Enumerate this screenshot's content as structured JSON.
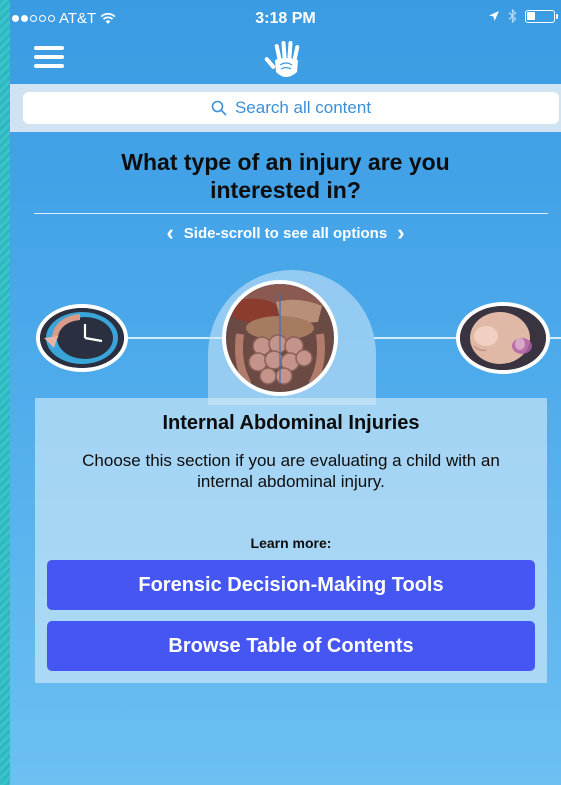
{
  "status_bar": {
    "carrier": "AT&T",
    "time": "3:18 PM",
    "icons": [
      "signal-dots-icon",
      "wifi-icon",
      "location-arrow-icon",
      "bluetooth-icon",
      "battery-icon"
    ]
  },
  "nav": {
    "menu_icon": "hamburger-menu-icon",
    "logo_icon": "hand-logo-icon"
  },
  "search": {
    "placeholder": "Search all content",
    "icon": "search-icon"
  },
  "prompt": {
    "question": "What type of an injury are you interested in?",
    "hint": "Side-scroll to see all options"
  },
  "carousel": {
    "items": [
      {
        "icon": "clock-injury-icon"
      },
      {
        "icon": "abdominal-organs-image",
        "selected": true
      },
      {
        "icon": "infant-head-image"
      }
    ]
  },
  "selected_section": {
    "title": "Internal Abdominal Injuries",
    "description": "Choose this section if you are evaluating a child with an internal abdominal injury.",
    "learn_more_label": "Learn more:",
    "buttons": {
      "forensic_tools": "Forensic Decision-Making Tools",
      "browse_toc": "Browse Table of Contents"
    }
  },
  "colors": {
    "background_top": "#3a9be3",
    "background_bottom": "#6cc0f2",
    "button": "#4656f2",
    "search_text": "#3b8fd8",
    "border_pattern": "#2fb7bf"
  }
}
